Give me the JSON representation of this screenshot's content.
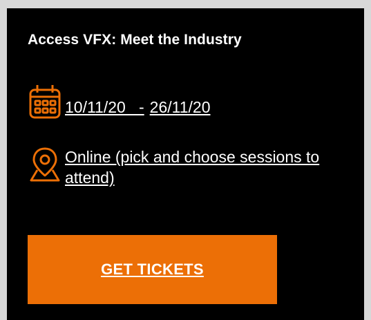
{
  "event": {
    "title": "Access VFX: Meet the Industry"
  },
  "dates": {
    "icon": "calendar-icon",
    "start": "10/11/20   ",
    "separator": "-",
    "end": "26/11/20"
  },
  "location": {
    "icon": "location-pin-icon",
    "label": "Online (pick and choose sessions to attend)"
  },
  "cta": {
    "label": "GET TICKETS"
  },
  "colors": {
    "accent": "#ec6f06",
    "card_background": "#000000",
    "page_background": "#d8d8d8",
    "text": "#ffffff"
  }
}
